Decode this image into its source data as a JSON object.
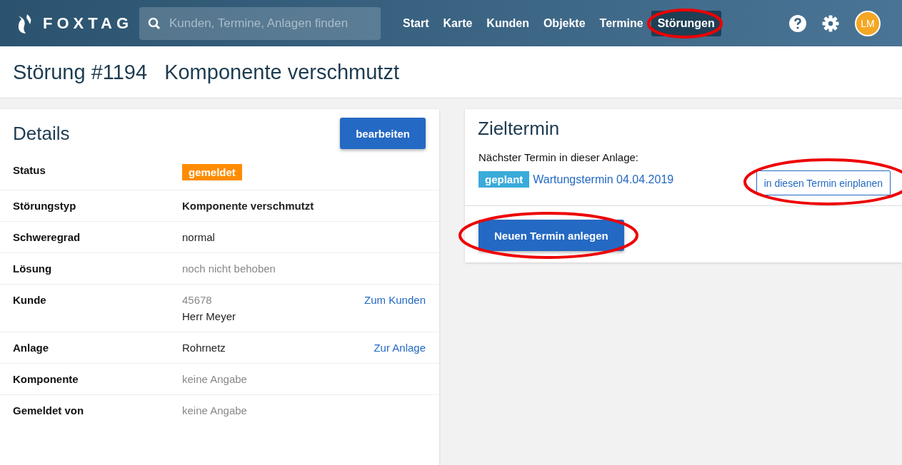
{
  "brand": "FOXTAG",
  "search": {
    "placeholder": "Kunden, Termine, Anlagen finden"
  },
  "nav": [
    {
      "label": "Start",
      "selected": false,
      "circled": false
    },
    {
      "label": "Karte",
      "selected": false,
      "circled": false
    },
    {
      "label": "Kunden",
      "selected": false,
      "circled": false
    },
    {
      "label": "Objekte",
      "selected": false,
      "circled": false
    },
    {
      "label": "Termine",
      "selected": false,
      "circled": false
    },
    {
      "label": "Störungen",
      "selected": true,
      "circled": true
    }
  ],
  "avatar": "LM",
  "page_title": {
    "number": "Störung #1194",
    "name": "Komponente verschmutzt"
  },
  "details": {
    "title": "Details",
    "edit_button": "bearbeiten",
    "rows": [
      {
        "label": "Status",
        "values": [
          {
            "text": "gemeldet",
            "kind": "badge"
          }
        ]
      },
      {
        "label": "Störungstyp",
        "values": [
          {
            "text": "Komponente verschmutzt",
            "kind": "strong"
          }
        ]
      },
      {
        "label": "Schweregrad",
        "values": [
          {
            "text": "normal",
            "kind": "plain"
          }
        ]
      },
      {
        "label": "Lösung",
        "values": [
          {
            "text": "noch nicht behoben",
            "kind": "muted"
          }
        ]
      },
      {
        "label": "Kunde",
        "values": [
          {
            "text": "45678",
            "kind": "muted"
          },
          {
            "text": "Herr Meyer",
            "kind": "plain"
          }
        ],
        "link": "Zum Kunden"
      },
      {
        "label": "Anlage",
        "values": [
          {
            "text": "Rohrnetz",
            "kind": "plain"
          }
        ],
        "link": "Zur Anlage"
      },
      {
        "label": "Komponente",
        "values": [
          {
            "text": "keine Angabe",
            "kind": "muted"
          }
        ]
      },
      {
        "label": "Gemeldet von",
        "values": [
          {
            "text": "keine Angabe",
            "kind": "muted"
          }
        ]
      }
    ]
  },
  "target": {
    "title": "Zieltermin",
    "subtitle": "Nächster Termin in dieser Anlage:",
    "badge": "geplant",
    "appointment": "Wartungstermin 04.04.2019",
    "plan_button": {
      "label": "in diesen Termin einplanen",
      "circled": true
    },
    "new_button": {
      "label": "Neuen Termin anlegen",
      "circled": true
    }
  }
}
